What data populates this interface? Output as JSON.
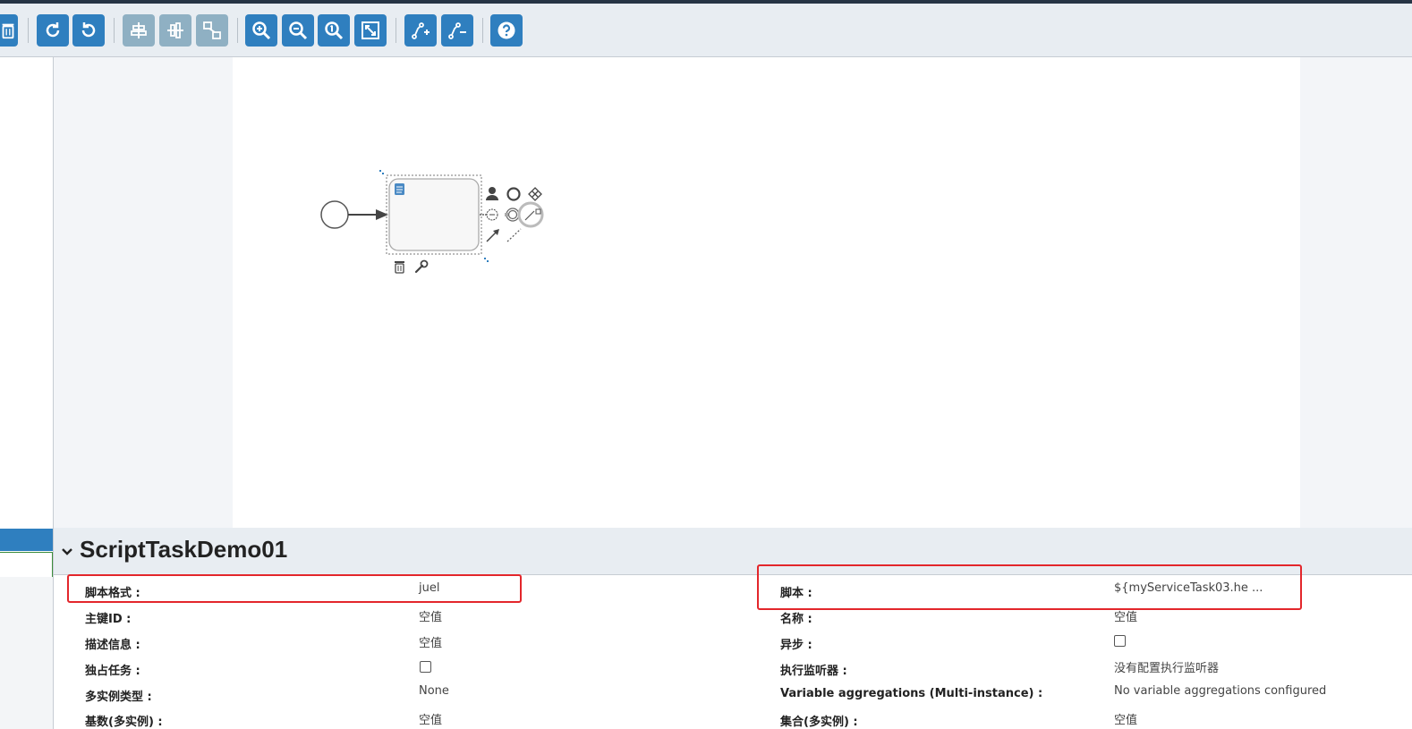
{
  "toolbar": {
    "buttons": [
      {
        "name": "delete-button",
        "icon": "trash-icon",
        "enabled": true
      },
      {
        "name": "redo-button",
        "icon": "redo-icon",
        "enabled": true
      },
      {
        "name": "undo-button",
        "icon": "undo-icon",
        "enabled": true
      },
      {
        "name": "align-horizontal-button",
        "icon": "align-horizontal-icon",
        "enabled": false
      },
      {
        "name": "align-vertical-button",
        "icon": "align-vertical-icon",
        "enabled": false
      },
      {
        "name": "same-size-button",
        "icon": "same-size-icon",
        "enabled": false
      },
      {
        "name": "zoom-in-button",
        "icon": "zoom-in-icon",
        "enabled": true
      },
      {
        "name": "zoom-out-button",
        "icon": "zoom-out-icon",
        "enabled": true
      },
      {
        "name": "zoom-actual-button",
        "icon": "zoom-actual-icon",
        "enabled": true
      },
      {
        "name": "zoom-fit-button",
        "icon": "zoom-fit-icon",
        "enabled": true
      },
      {
        "name": "add-bendpoint-button",
        "icon": "add-bendpoint-icon",
        "enabled": true
      },
      {
        "name": "remove-bendpoint-button",
        "icon": "remove-bendpoint-icon",
        "enabled": true
      },
      {
        "name": "help-button",
        "icon": "question-icon",
        "enabled": true
      }
    ]
  },
  "diagram": {
    "elements": [
      "start-event",
      "sequence-flow",
      "script-task"
    ],
    "quick_menu": [
      "user-task-icon",
      "end-event-icon",
      "gateway-icon",
      "intermediate-event-icon",
      "boundary-event-icon",
      "connect-icon",
      "association-icon",
      "delete-icon",
      "wrench-icon"
    ]
  },
  "properties": {
    "title": "ScriptTaskDemo01",
    "left": [
      {
        "label": "脚本格式 :",
        "value": "juel"
      },
      {
        "label": "主键ID :",
        "value": "空值"
      },
      {
        "label": "描述信息 :",
        "value": "空值"
      },
      {
        "label": "独占任务 :",
        "value": "",
        "checkbox": true
      },
      {
        "label": "多实例类型 :",
        "value": "None"
      },
      {
        "label": "基数(多实例) :",
        "value": "空值"
      }
    ],
    "right": [
      {
        "label": "脚本 :",
        "value": "${myServiceTask03.he ..."
      },
      {
        "label": "名称 :",
        "value": "空值"
      },
      {
        "label": "异步 :",
        "value": "",
        "checkbox": true
      },
      {
        "label": "执行监听器 :",
        "value": "没有配置执行监听器"
      },
      {
        "label": "Variable aggregations (Multi-instance) :",
        "value": "No variable aggregations configured"
      },
      {
        "label": "集合(多实例) :",
        "value": "空值"
      }
    ]
  },
  "colors": {
    "primary_button": "#2f7fbf",
    "disabled_button": "#8fb0c3",
    "highlight": "#e3262b",
    "toolbar_bg": "#e8edf2"
  }
}
